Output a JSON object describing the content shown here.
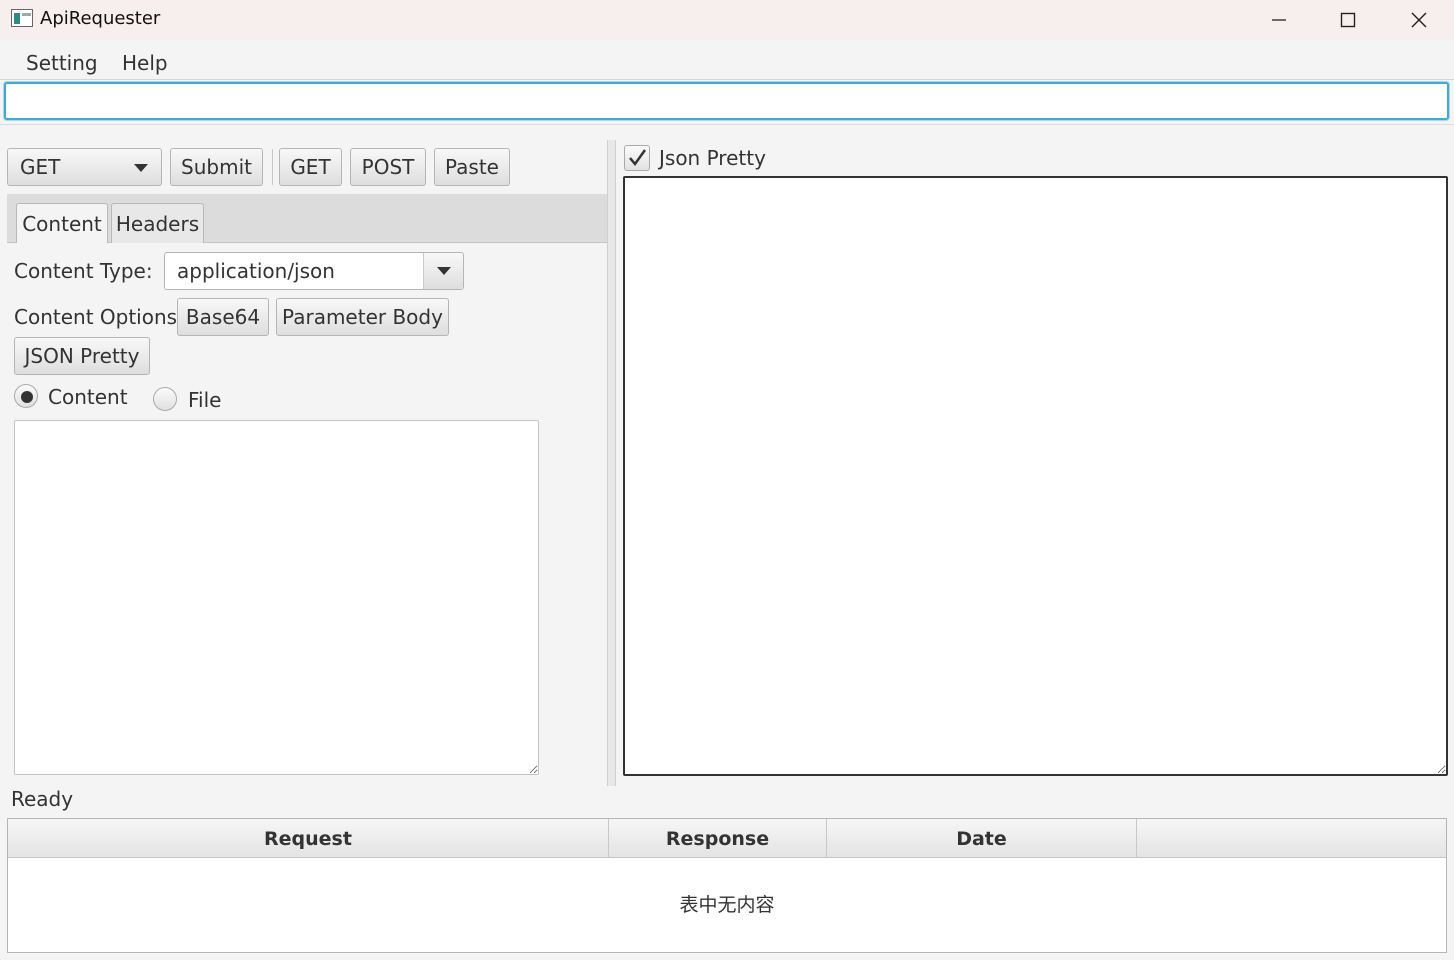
{
  "window": {
    "title": "ApiRequester"
  },
  "menu": {
    "items": [
      "Setting",
      "Help"
    ]
  },
  "url_input": {
    "value": ""
  },
  "toolbar": {
    "method": "GET",
    "submit": "Submit",
    "get": "GET",
    "post": "POST",
    "paste": "Paste"
  },
  "tabs": [
    {
      "label": "Content",
      "selected": true
    },
    {
      "label": "Headers",
      "selected": false
    }
  ],
  "content_panel": {
    "content_type_label": "Content Type:",
    "content_type_value": "application/json",
    "content_options_label": "Content Options:",
    "options": [
      "Base64",
      "Parameter Body",
      "JSON Pretty"
    ],
    "radio_content": "Content",
    "radio_file": "File",
    "radio_selected": "Content",
    "body": ""
  },
  "response_panel": {
    "json_pretty_label": "Json Pretty",
    "json_pretty_checked": true,
    "body": ""
  },
  "status": "Ready",
  "history_table": {
    "columns": [
      "Request",
      "Response",
      "Date",
      ""
    ],
    "rows": [],
    "empty_text": "表中无内容"
  }
}
